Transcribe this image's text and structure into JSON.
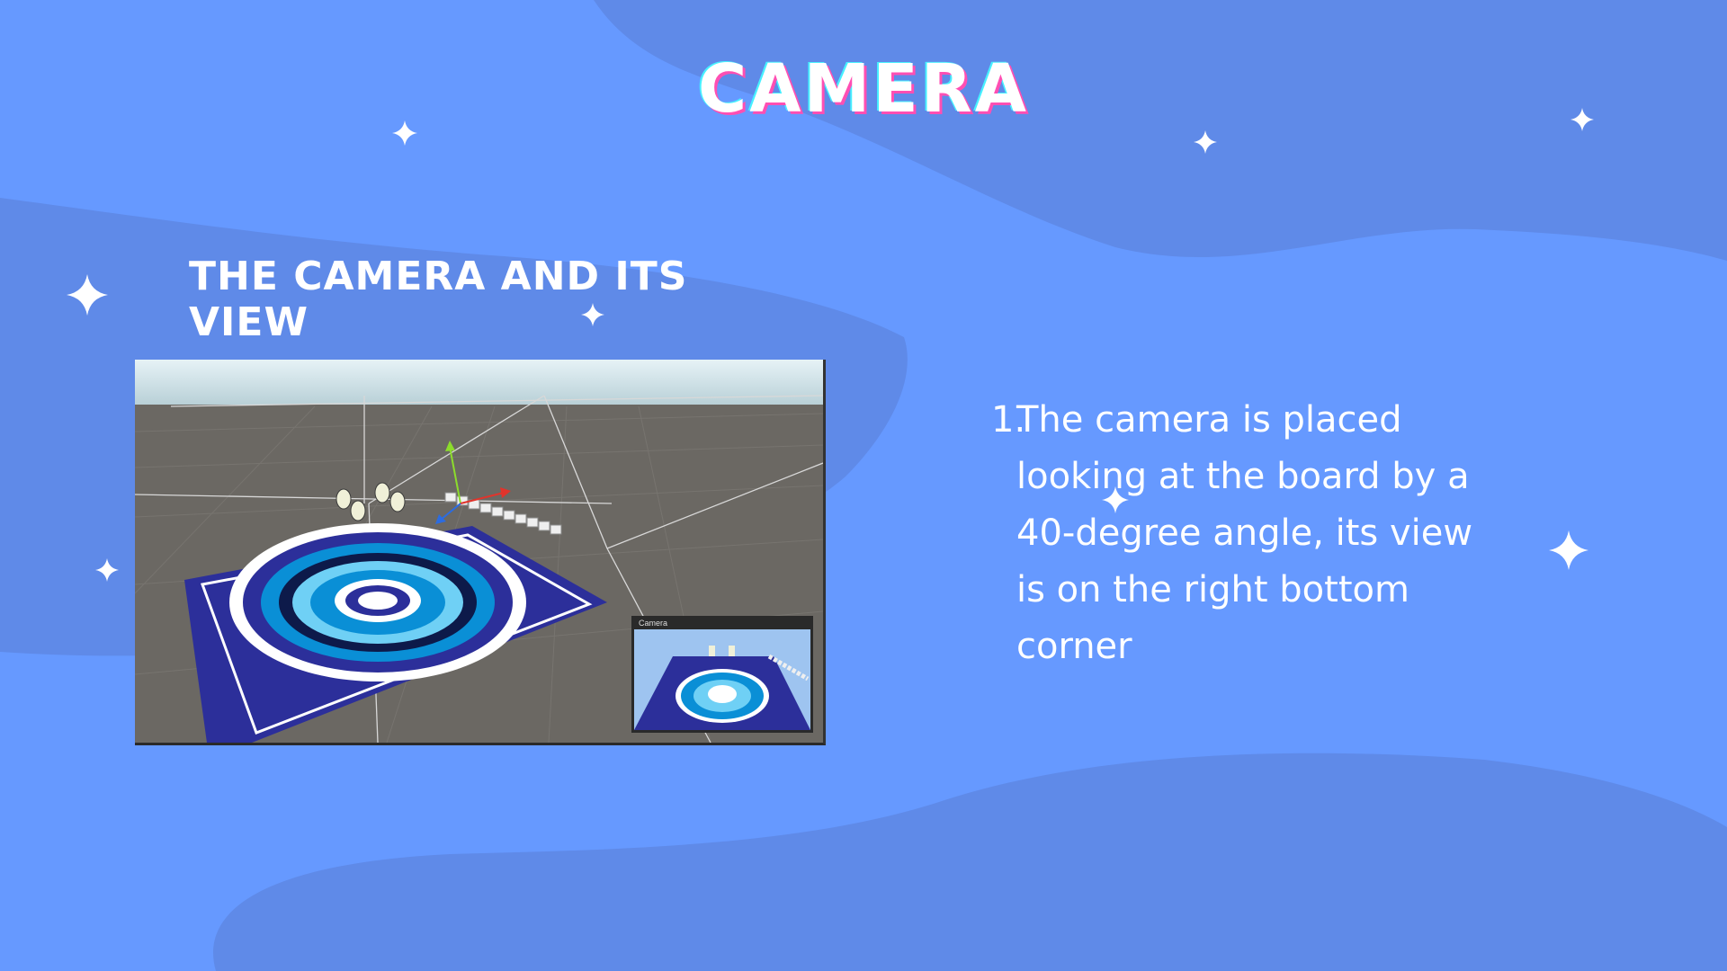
{
  "slide": {
    "title": "CAMERA",
    "subtitle": "THE CAMERA AND ITS VIEW",
    "colors": {
      "background": "#6699ff",
      "blob": "#5f8ae8",
      "text": "#ffffff",
      "title_shadow_pink": "#ff4fb3",
      "title_shadow_cyan": "#47f0ff"
    }
  },
  "screenshot": {
    "preview_label": "Camera",
    "icons": [
      "move-gizmo-icon",
      "camera-frustum-icon",
      "sparkle-star-icon"
    ]
  },
  "points": [
    {
      "number": "1.",
      "text": "The camera is placed looking at the board by a 40-degree angle, its view is on the right bottom corner"
    }
  ]
}
